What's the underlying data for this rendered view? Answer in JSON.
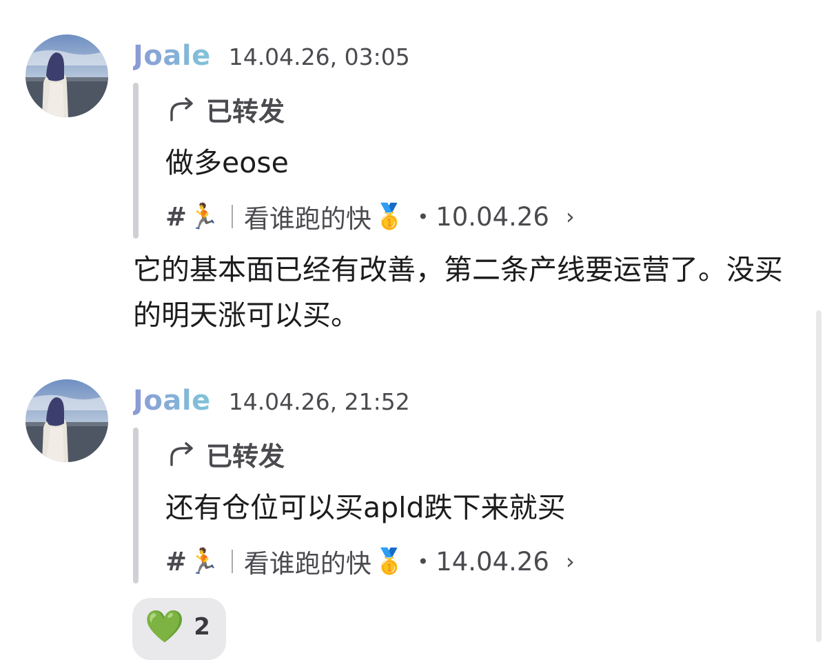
{
  "messages": [
    {
      "sender": "Joale",
      "timestamp": "14.04.26, 03:05",
      "forward": {
        "label": "已转发",
        "text": "做多eose",
        "source": {
          "hash": "#",
          "runner": "🏃",
          "channel": "看谁跑的快",
          "medal": "🥇",
          "dot": "•",
          "date": "10.04.26",
          "chevron": "›"
        }
      },
      "body": "它的基本面已经有改善，第二条产线要运营了。没买的明天涨可以买。"
    },
    {
      "sender": "Joale",
      "timestamp": "14.04.26, 21:52",
      "forward": {
        "label": "已转发",
        "text": "还有仓位可以买apld跌下来就买",
        "source": {
          "hash": "#",
          "runner": "🏃",
          "channel": "看谁跑的快",
          "medal": "🥇",
          "dot": "•",
          "date": "14.04.26",
          "chevron": "›"
        }
      },
      "reaction": {
        "emoji": "💚",
        "count": "2"
      }
    }
  ],
  "colors": {
    "sender_gradient_start": "#8b9ad6",
    "sender_gradient_end": "#7fc4d8",
    "forward_bar": "#d0d0d4",
    "reaction_bg": "#e9e9ec"
  },
  "icons": {
    "forward": "forward-arrow-icon",
    "chevron": "chevron-right-icon",
    "avatar": "avatar-photo"
  }
}
